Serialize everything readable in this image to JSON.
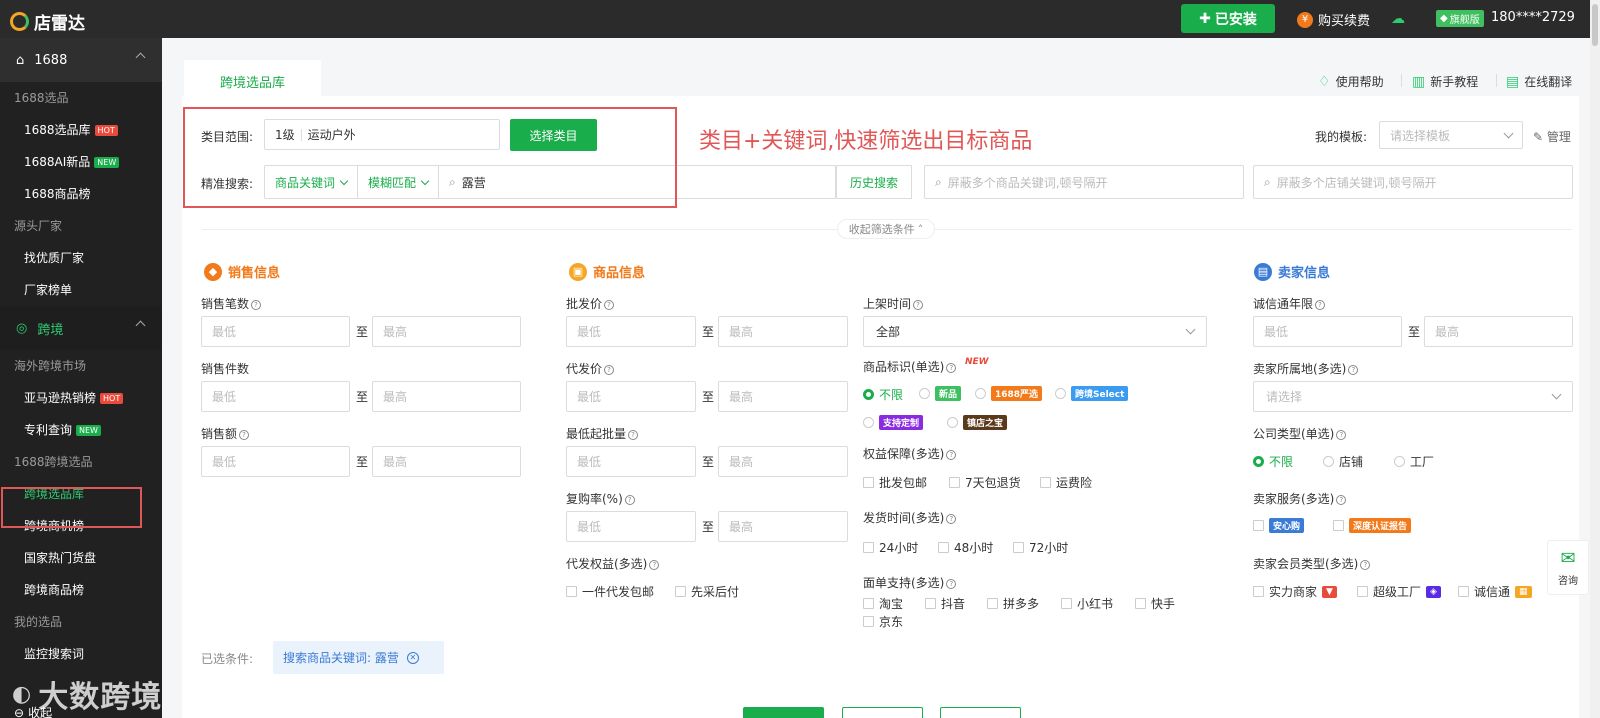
{
  "topbar": {
    "app_name": "店雷达",
    "installed_label": "已安装",
    "buy_label": "购买续费",
    "vip_label": "旗舰版",
    "phone": "180****2729"
  },
  "sidebar": {
    "group_1688": "1688",
    "sec_1688": "1688选品",
    "item_1688_lib": "1688选品库",
    "item_1688_ai": "1688AI新品",
    "item_1688_rank": "1688商品榜",
    "sec_factory": "源头厂家",
    "item_factory_find": "找优质厂家",
    "item_factory_rank": "厂家榜单",
    "group_cross": "跨境",
    "sec_overseas": "海外跨境市场",
    "item_amazon": "亚马逊热销榜",
    "item_patent": "专利查询",
    "sec_1688cross": "1688跨境选品",
    "item_cross_lib": "跨境选品库",
    "item_cross_biz": "跨境商机榜",
    "item_country": "国家热门货盘",
    "item_cross_rank": "跨境商品榜",
    "sec_mine": "我的选品",
    "item_keyword": "监控搜索词",
    "collapse": "收起",
    "hot": "HOT",
    "new": "NEW",
    "watermark": "大数跨境"
  },
  "main": {
    "tab_label": "跨境选品库",
    "help": "使用帮助",
    "tutorial": "新手教程",
    "translate": "在线翻译",
    "category_label": "类目范围:",
    "category_level": "1级",
    "category_value": "运动户外",
    "select_category_btn": "选择类目",
    "precise_label": "精准搜索:",
    "keyword_type": "商品关键词",
    "match_type": "模糊匹配",
    "search_value": "露营",
    "history_btn": "历史搜索",
    "exclude_goods_ph": "屏蔽多个商品关键词,顿号隔开",
    "exclude_shop_ph": "屏蔽多个店铺关键词,顿号隔开",
    "template_label": "我的模板:",
    "template_ph": "请选择模板",
    "manage_label": "管理",
    "hint_text": "类目+关键词,快速筛选出目标商品",
    "collapse_filter": "收起筛选条件"
  },
  "filters": {
    "min_ph": "最低",
    "max_ph": "最高",
    "to": "至",
    "sales": {
      "title": "销售信息",
      "count": "销售笔数",
      "pieces": "销售件数",
      "amount": "销售额"
    },
    "goods": {
      "title": "商品信息",
      "wholesale": "批发价",
      "dropship": "代发价",
      "moq": "最低起批量",
      "repurchase": "复购率(%)",
      "dropship_rights": "代发权益(多选)",
      "opt_one_piece": "一件代发包邮",
      "opt_try_first": "先采后付",
      "listed_time": "上架时间",
      "listed_all": "全部",
      "mark_label": "商品标识(单选)",
      "mark_new": "NEW",
      "opt_unlimited": "不限",
      "tag_new": "新品",
      "tag_yanxuan": "1688严选",
      "tag_select": "跨境Select",
      "tag_custom": "支持定制",
      "tag_treasure": "镇店之宝",
      "rights_label": "权益保障(多选)",
      "opt_free_ship": "批发包邮",
      "opt_7day": "7天包退货",
      "opt_freight": "运费险",
      "ship_label": "发货时间(多选)",
      "opt_24h": "24小时",
      "opt_48h": "48小时",
      "opt_72h": "72小时",
      "waybill_label": "面单支持(多选)",
      "opt_taobao": "淘宝",
      "opt_douyin": "抖音",
      "opt_pdd": "拼多多",
      "opt_xhs": "小红书",
      "opt_kuaishou": "快手",
      "opt_jd": "京东"
    },
    "seller": {
      "title": "卖家信息",
      "years": "诚信通年限",
      "region": "卖家所属地(多选)",
      "region_ph": "请选择",
      "company": "公司类型(单选)",
      "opt_unlimited": "不限",
      "opt_store": "店铺",
      "opt_factory": "工厂",
      "service": "卖家服务(多选)",
      "tag_anxin": "安心购",
      "tag_deep": "深度认证报告",
      "member": "卖家会员类型(多选)",
      "opt_strong": "实力商家",
      "opt_super": "超级工厂",
      "opt_cxt": "诚信通"
    },
    "selected_label": "已选条件:",
    "selected_chip": "搜索商品关键词: 露营"
  },
  "consult_label": "咨询"
}
